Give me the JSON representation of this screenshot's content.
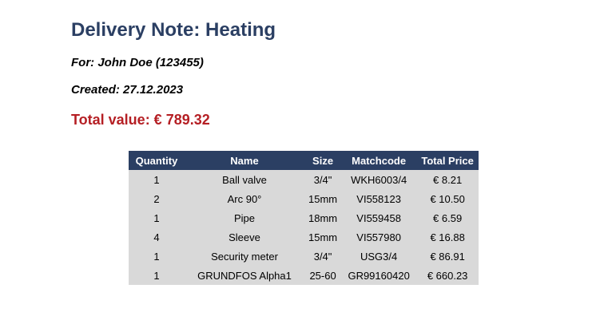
{
  "document": {
    "title": "Delivery Note: Heating",
    "for_line": "For: John Doe (123455)",
    "created_line": "Created: 27.12.2023",
    "total_line": "Total value: € 789.32"
  },
  "colors": {
    "heading": "#2b3f63",
    "total": "#b51f24",
    "table_header_bg": "#2b3f63",
    "table_row_bg": "#d9d9d9"
  },
  "table": {
    "headers": [
      "Quantity",
      "Name",
      "Size",
      "Matchcode",
      "Total Price"
    ],
    "rows": [
      [
        "1",
        "Ball valve",
        "3/4\"",
        "WKH6003/4",
        "€ 8.21"
      ],
      [
        "2",
        "Arc 90°",
        "15mm",
        "VI558123",
        "€ 10.50"
      ],
      [
        "1",
        "Pipe",
        "18mm",
        "VI559458",
        "€ 6.59"
      ],
      [
        "4",
        "Sleeve",
        "15mm",
        "VI557980",
        "€ 16.88"
      ],
      [
        "1",
        "Security meter",
        "3/4\"",
        "USG3/4",
        "€ 86.91"
      ],
      [
        "1",
        "GRUNDFOS Alpha1",
        "25-60",
        "GR99160420",
        "€ 660.23"
      ]
    ]
  }
}
